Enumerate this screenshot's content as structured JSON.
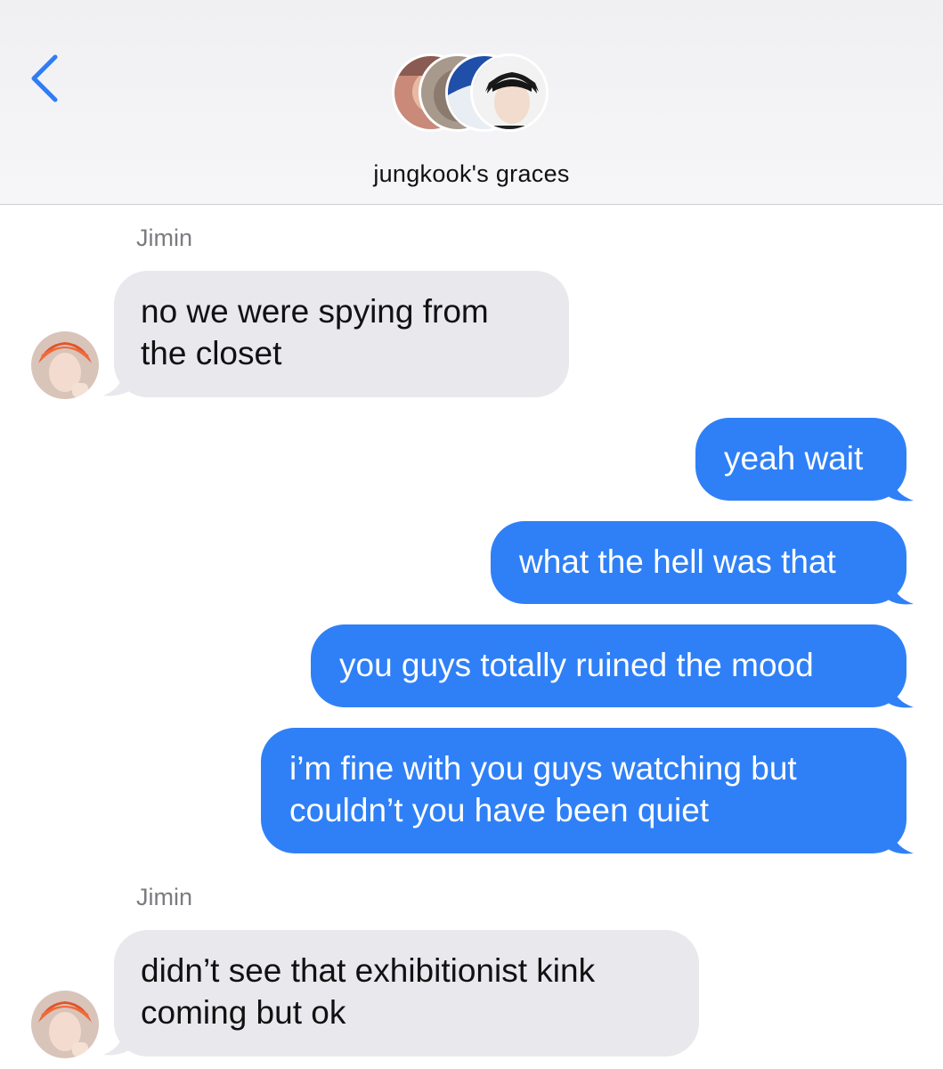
{
  "header": {
    "title": "jungkook's graces",
    "back_icon": "chevron-left-icon",
    "accent_color": "#2f7cf6"
  },
  "messages": [
    {
      "from": "Jimin",
      "direction": "received",
      "sender_label": "Jimin",
      "lines": [
        "no we were spying from",
        "the closet"
      ]
    },
    {
      "from": "me",
      "direction": "sent",
      "lines": [
        "yeah wait"
      ]
    },
    {
      "from": "me",
      "direction": "sent",
      "lines": [
        "what the hell was that"
      ]
    },
    {
      "from": "me",
      "direction": "sent",
      "lines": [
        "you guys totally ruined the mood"
      ]
    },
    {
      "from": "me",
      "direction": "sent",
      "lines": [
        "i’m fine with you guys watching but",
        "couldn’t you have been quiet"
      ]
    },
    {
      "from": "Jimin",
      "direction": "received",
      "sender_label": "Jimin",
      "lines": [
        "didn’t see that exhibitionist kink",
        "coming but ok"
      ]
    }
  ],
  "colors": {
    "sent_bubble": "#2f80f7",
    "received_bubble": "#e8e8ed",
    "sender_label": "#7b7b80"
  }
}
